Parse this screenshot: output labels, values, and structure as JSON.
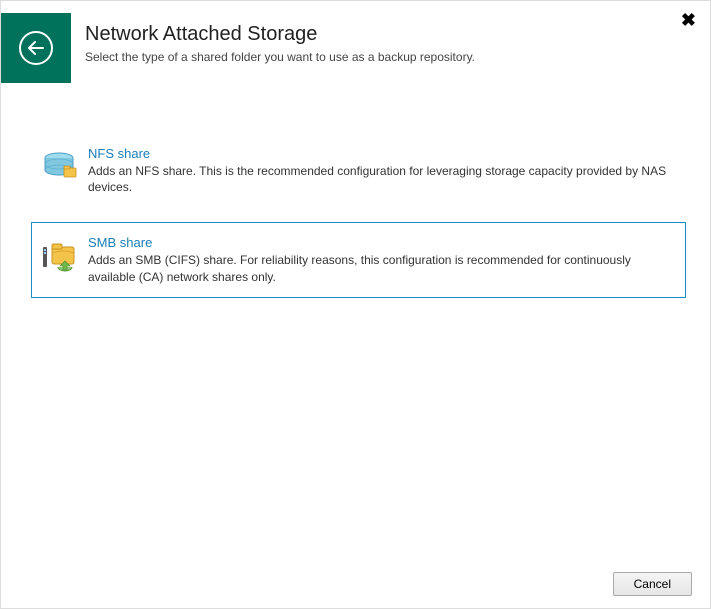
{
  "header": {
    "title": "Network Attached Storage",
    "subtitle": "Select the type of a shared folder you want to use as a backup repository."
  },
  "options": [
    {
      "id": "nfs",
      "title": "NFS share",
      "description": "Adds an NFS share. This is the recommended configuration for leveraging storage capacity provided by NAS devices.",
      "selected": false,
      "icon": "nfs-icon"
    },
    {
      "id": "smb",
      "title": "SMB share",
      "description": "Adds an SMB (CIFS) share. For reliability reasons, this configuration is recommended for continuously available (CA) network shares only.",
      "selected": true,
      "icon": "smb-icon"
    }
  ],
  "footer": {
    "cancel_label": "Cancel"
  }
}
